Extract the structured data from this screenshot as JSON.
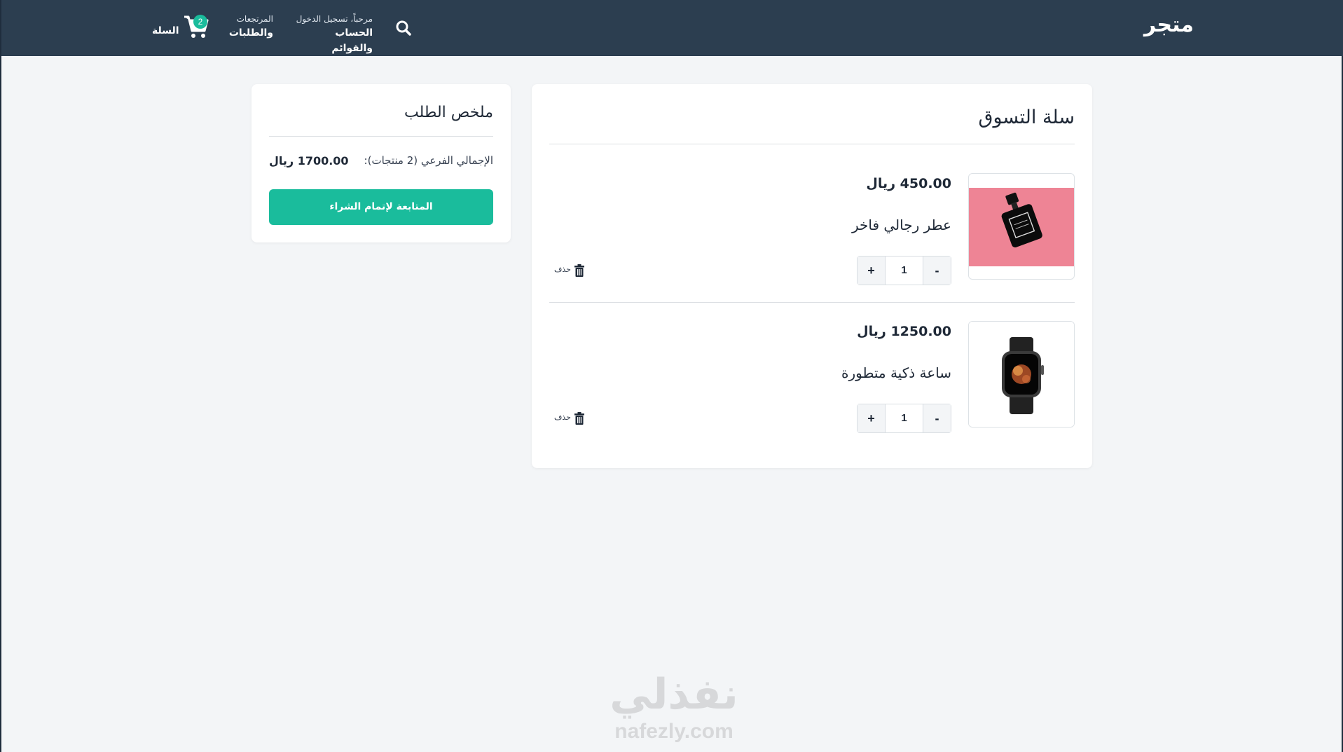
{
  "header": {
    "brand": "متجر",
    "account_small": "مرحباً، تسجيل الدخول",
    "account_big": "الحساب والقوائم",
    "orders_small": "المرتجعات",
    "orders_big": "والطلبات",
    "cart_label": "السلة",
    "cart_count": "2",
    "search_icon": "search-icon",
    "cart_icon": "cart-icon"
  },
  "cart": {
    "title": "سلة التسوق",
    "items": [
      {
        "price": "450.00 ريال",
        "name": "عطر رجالي فاخر",
        "quantity": "1",
        "plus": "+",
        "minus": "-",
        "delete_label": "حذف",
        "image": "perfume-bottle-image"
      },
      {
        "price": "1250.00 ريال",
        "name": "ساعة ذكية متطورة",
        "quantity": "1",
        "plus": "+",
        "minus": "-",
        "delete_label": "حذف",
        "image": "smartwatch-image"
      }
    ]
  },
  "summary": {
    "title": "ملخص الطلب",
    "subtotal_label": "الإجمالي الفرعي (2 منتجات):",
    "subtotal_value": "1700.00 ريال",
    "checkout_label": "المتابعة لإتمام الشراء"
  },
  "watermark": {
    "arabic": "نفذلي",
    "latin": "nafezly.com"
  },
  "colors": {
    "navbar": "#2c3e50",
    "accent": "#1abc9c",
    "background": "#f3f5f7",
    "perfume_bg": "#ee8495"
  }
}
